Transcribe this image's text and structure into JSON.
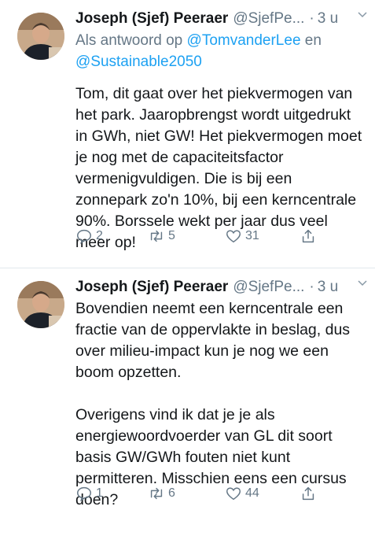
{
  "tweets": [
    {
      "name": "Joseph (Sjef) Peeraer",
      "handle": "@SjefPe...",
      "dot": "·",
      "time": "3 u",
      "reply_prefix": "Als antwoord op",
      "reply_user1": "@TomvanderLee",
      "reply_and": "en",
      "reply_user2": "@Sustainable2050",
      "text": "Tom, dit gaat over het piekvermogen van het park. Jaaropbrengst wordt uitgedrukt in GWh, niet GW! Het piekvermogen moet je nog met de capaciteitsfactor vermenigvuldigen. Die is bij een zonnepark zo'n 10%, bij een kerncentrale 90%. Borssele wekt per jaar dus veel meer op!",
      "replies": "2",
      "retweets": "5",
      "likes": "31"
    },
    {
      "name": "Joseph (Sjef) Peeraer",
      "handle": "@SjefPe...",
      "dot": "·",
      "time": "3 u",
      "text": "Bovendien neemt een kerncentrale een fractie van de oppervlakte in beslag, dus over milieu-impact kun je nog we een boom opzetten.\n\nOverigens vind ik dat je je als energiewoordvoerder van GL dit soort basis GW/GWh fouten niet kunt permitteren. Misschien eens een cursus doen?",
      "replies": "1",
      "retweets": "6",
      "likes": "44"
    }
  ],
  "icons": {
    "reply": "reply-icon",
    "retweet": "retweet-icon",
    "like": "heart-icon",
    "share": "share-icon",
    "more": "chevron-down-icon"
  },
  "colors": {
    "text": "#14171a",
    "muted": "#657786",
    "link": "#1da1f2"
  }
}
